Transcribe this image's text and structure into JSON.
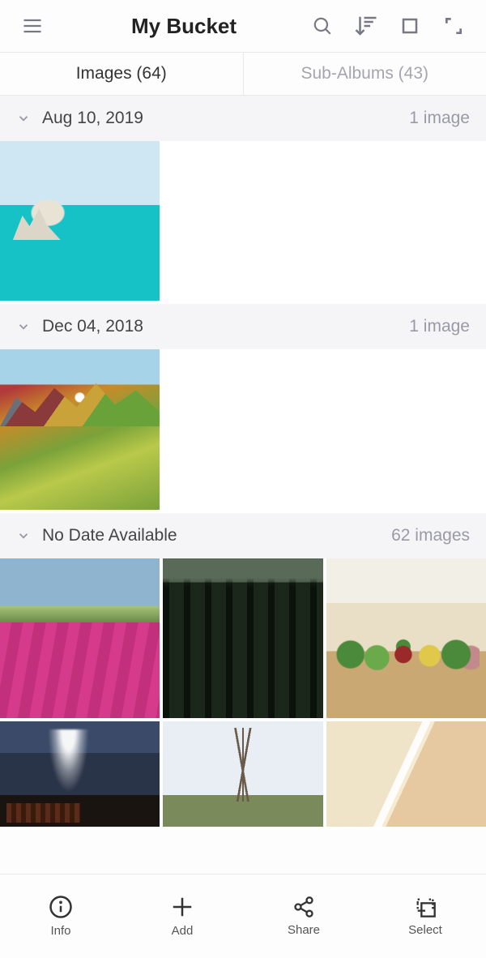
{
  "header": {
    "title": "My Bucket"
  },
  "tabs": {
    "images": {
      "label": "Images",
      "count": 64,
      "text": "Images (64)"
    },
    "subalbums": {
      "label": "Sub-Albums",
      "count": 43,
      "text": "Sub-Albums (43)"
    }
  },
  "sections": [
    {
      "date": "Aug 10, 2019",
      "count_text": "1 image",
      "count": 1
    },
    {
      "date": "Dec 04, 2018",
      "count_text": "1 image",
      "count": 1
    },
    {
      "date": "No Date Available",
      "count_text": "62 images",
      "count": 62
    }
  ],
  "toolbar": {
    "info": "Info",
    "add": "Add",
    "share": "Share",
    "select": "Select"
  }
}
